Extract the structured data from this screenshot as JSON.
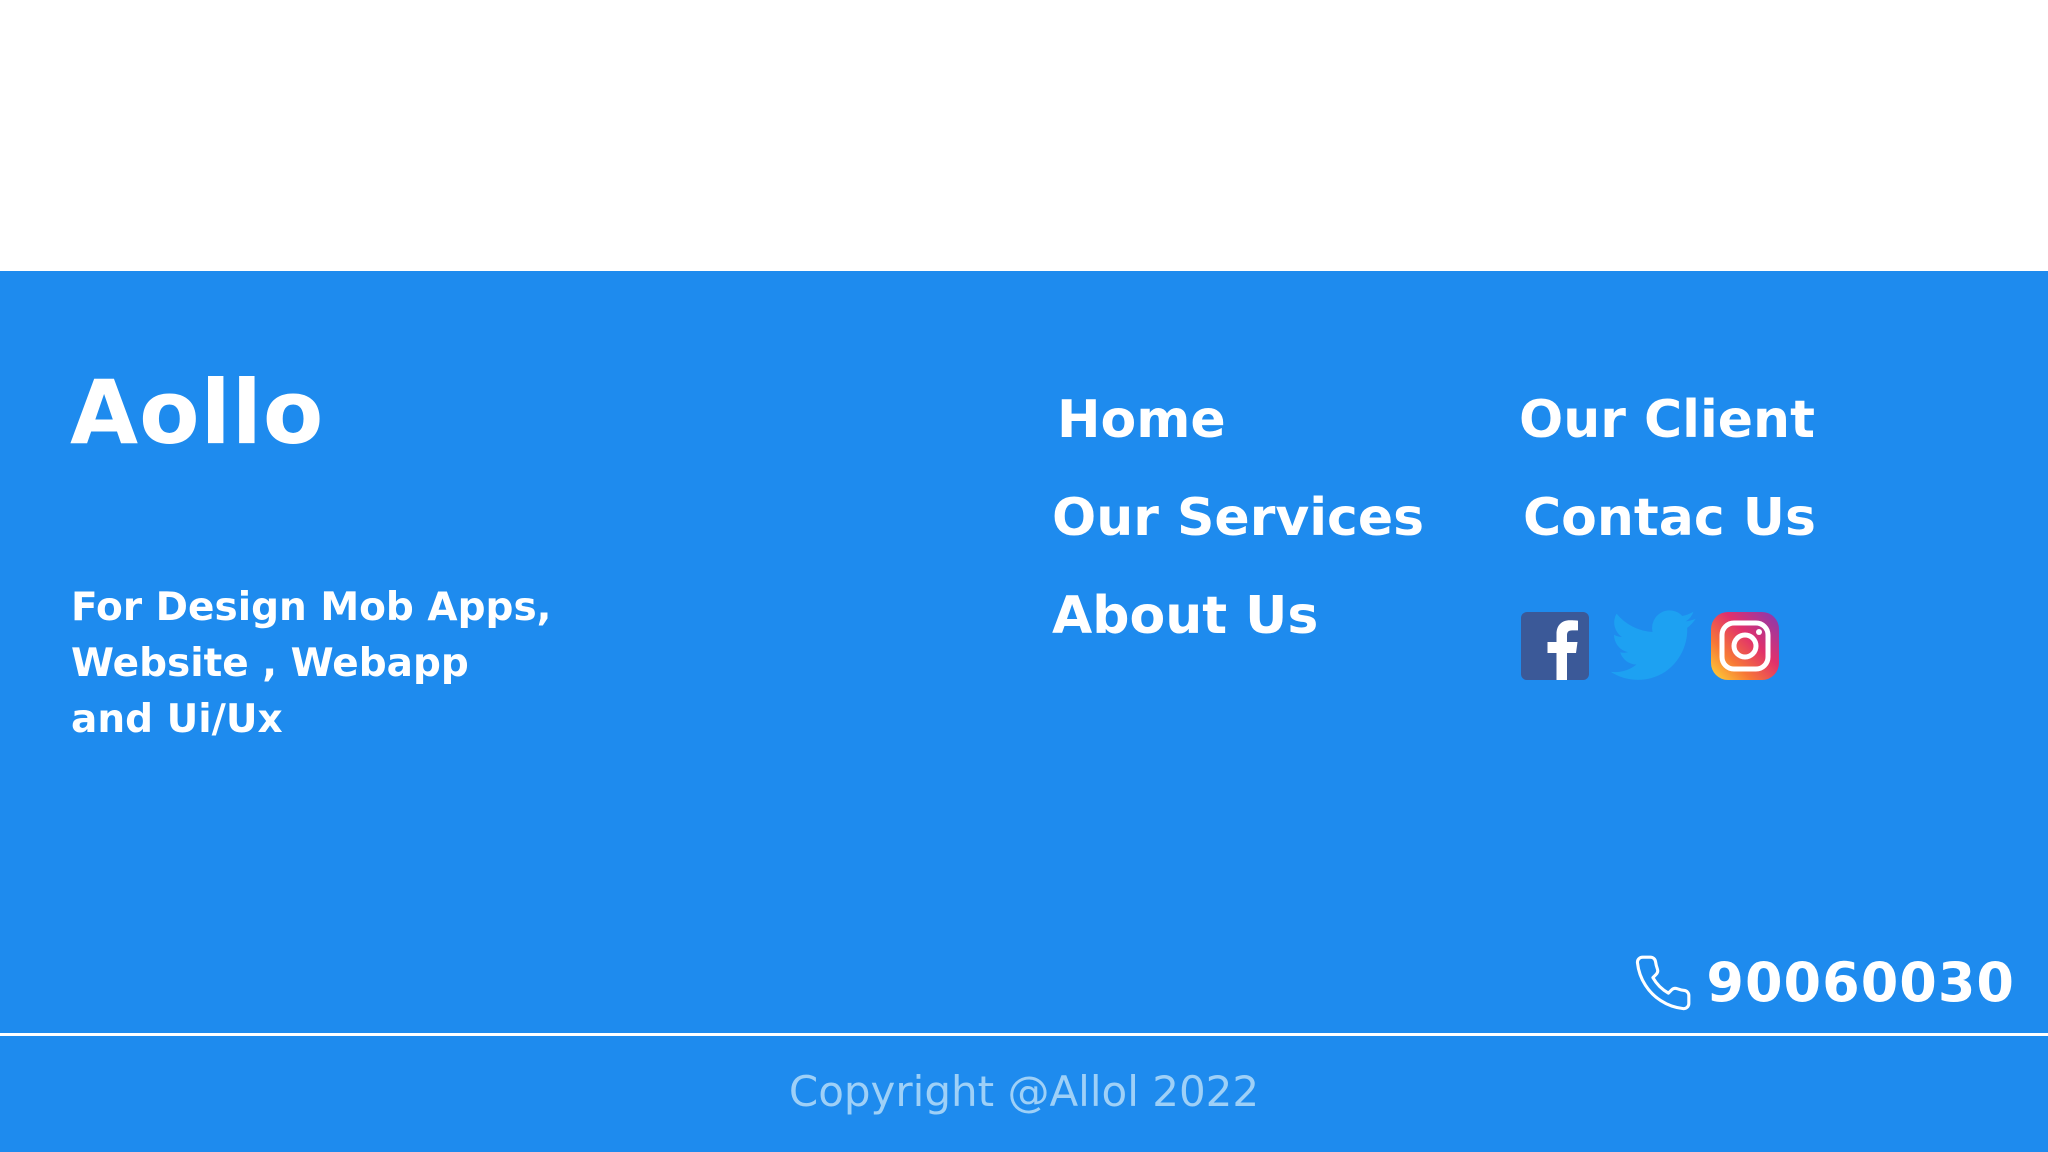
{
  "brand": {
    "name": "Aollo",
    "tagline": [
      "For Design Mob Apps,",
      "Website , Webapp",
      "and Ui/Ux"
    ]
  },
  "nav": {
    "col1": [
      "Home",
      "Our Services",
      "About Us"
    ],
    "col2": [
      "Our Client",
      "Contac Us"
    ]
  },
  "social": [
    {
      "icon": "facebook-icon",
      "color": "#3b5998"
    },
    {
      "icon": "twitter-icon",
      "color": "#1da1f2"
    },
    {
      "icon": "instagram-icon",
      "color": "#e1306c"
    }
  ],
  "contact": {
    "icon": "phone-icon",
    "phone": "90060030"
  },
  "copyright": "Copyright @Allol 2022",
  "colors": {
    "footer_bg": "#1e8bee",
    "text": "#ffffff",
    "copyright_text": "#9ed0f7"
  }
}
